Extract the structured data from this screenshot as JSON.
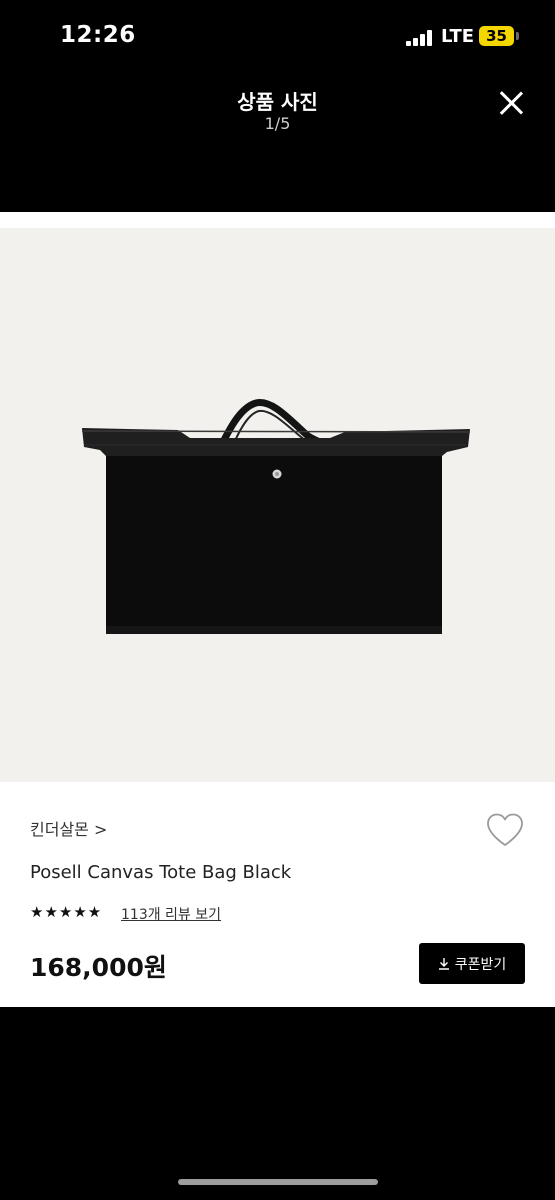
{
  "status_bar": {
    "time": "12:26",
    "network": "LTE",
    "battery": "35"
  },
  "header": {
    "title": "상품 사진",
    "counter": "1/5"
  },
  "product": {
    "brand": "킨더살몬 >",
    "name": "Posell Canvas Tote Bag Black",
    "stars": "★★★★★",
    "rating": 5,
    "reviews": "113개 리뷰 보기",
    "price": "168,000원",
    "coupon_label": "쿠폰받기",
    "image_desc_icon": "bag-image"
  },
  "colors": {
    "accent": "#000000",
    "photo_bg": "#f2f1ed",
    "battery": "#f5d700"
  }
}
